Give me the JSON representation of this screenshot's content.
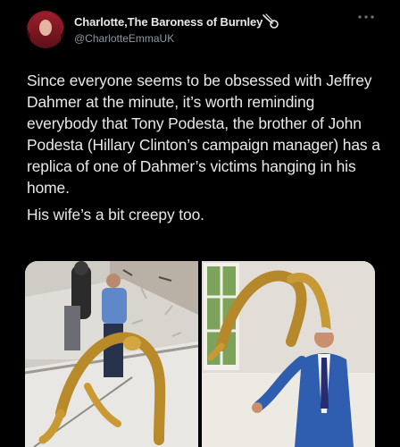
{
  "tweet": {
    "author": {
      "display_name": "Charlotte,The Baroness of Burnley",
      "handle": "@CharlotteEmmaUK",
      "badge_icon": "comet-icon",
      "more_icon": "more-dots-icon"
    },
    "paragraphs": [
      "Since everyone seems to be obsessed with Jeffrey Dahmer at the minute, it’s worth reminding everybody that Tony Podesta, the brother of John Podesta (Hillary Clinton’s campaign manager) has a replica of one of Dahmer’s victims hanging in his home.",
      "His wife’s a bit creepy too."
    ],
    "media": [
      {
        "subject": "gold contorted figure sculpture on staircase with two people"
      },
      {
        "subject": "man in blue suit beside gold suspended figure sculpture"
      }
    ]
  },
  "colors": {
    "background": "#000000",
    "text": "#e7e9ea",
    "secondary_text": "#8b98a5"
  }
}
